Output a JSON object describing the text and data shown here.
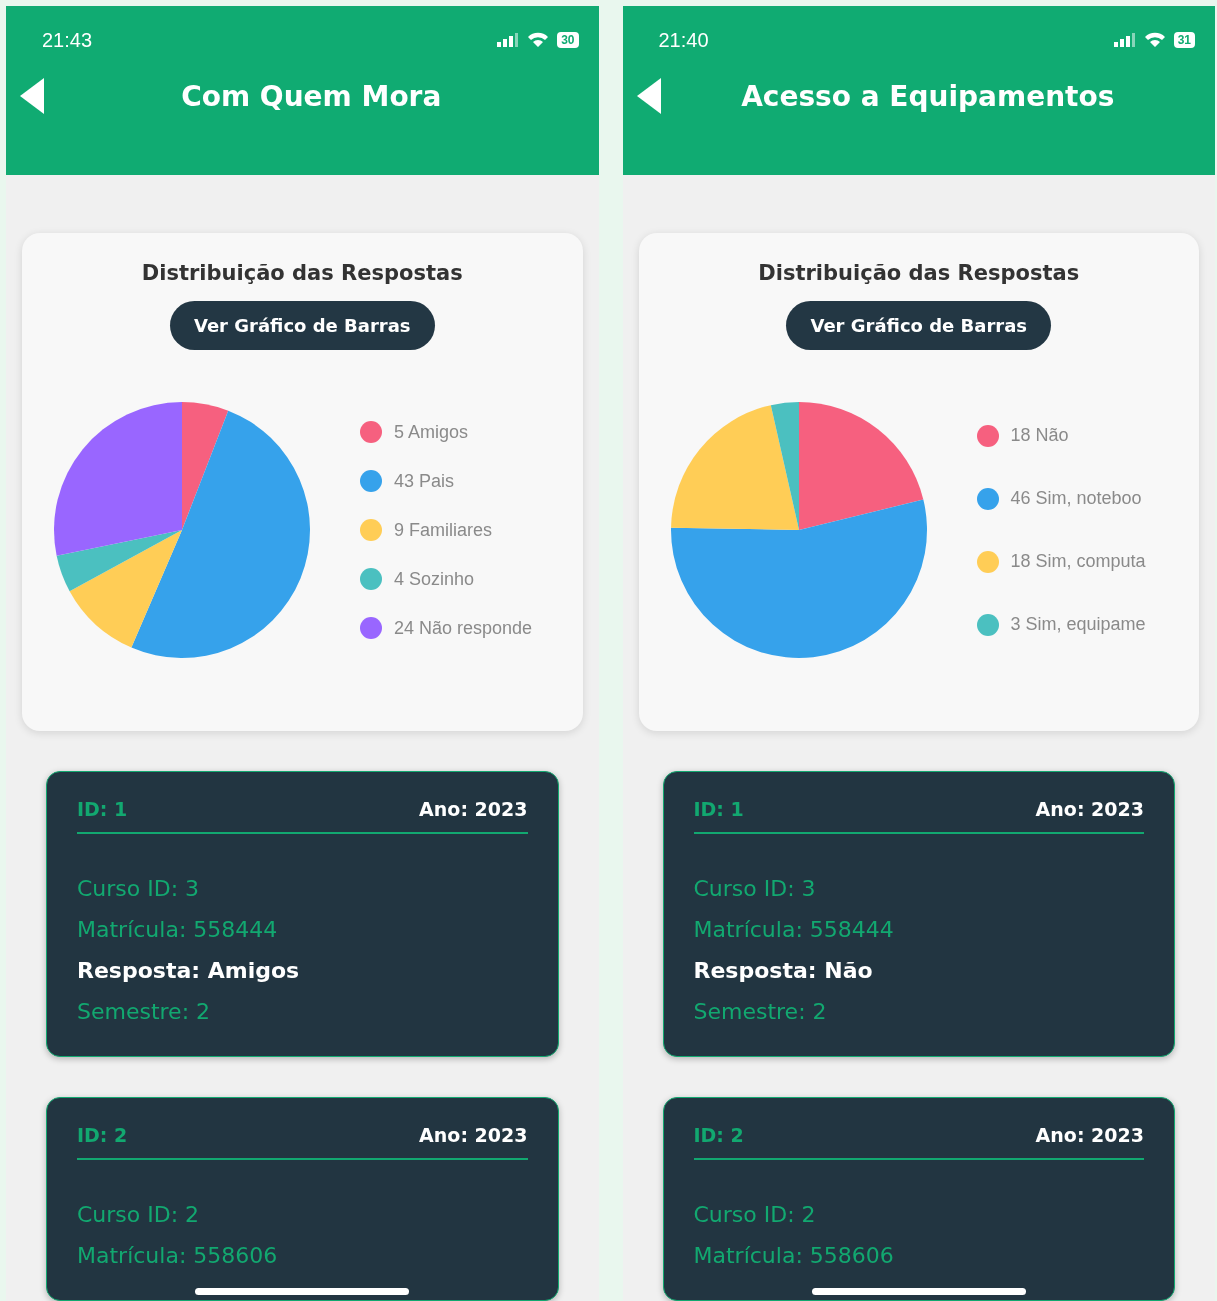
{
  "phones": [
    {
      "status_bar": {
        "time": "21:43",
        "battery": "30"
      },
      "header": {
        "title": "Com Quem Mora"
      },
      "chart_card": {
        "title": "Distribuição das Respostas",
        "button": "Ver Gráfico de Barras",
        "legend": [
          {
            "color": "#f6607f"
          },
          {
            "color": "#36a2eb"
          },
          {
            "color": "#ffcd56"
          },
          {
            "color": "#4bc0c0"
          },
          {
            "color": "#9966ff"
          }
        ],
        "chart_data": {
          "type": "pie",
          "categories": [
            "5 Amigos",
            "43 Pais",
            "9 Familiares",
            "4 Sozinho",
            "24 Não responde"
          ],
          "values": [
            5,
            43,
            9,
            4,
            24
          ]
        }
      },
      "records": [
        {
          "id": "ID: 1",
          "year": "Ano: 2023",
          "fields": [
            {
              "kind": "info",
              "text": "Curso ID: 3"
            },
            {
              "kind": "info",
              "text": "Matrícula: 558444"
            },
            {
              "kind": "answer",
              "text": "Resposta: Amigos"
            },
            {
              "kind": "info",
              "text": "Semestre: 2"
            }
          ]
        },
        {
          "id": "ID: 2",
          "year": "Ano: 2023",
          "fields": [
            {
              "kind": "info",
              "text": "Curso ID: 2"
            },
            {
              "kind": "info",
              "text": "Matrícula: 558606"
            }
          ]
        }
      ]
    },
    {
      "status_bar": {
        "time": "21:40",
        "battery": "31"
      },
      "header": {
        "title": "Acesso a Equipamentos"
      },
      "chart_card": {
        "title": "Distribuição das Respostas",
        "button": "Ver Gráfico de Barras",
        "legend": [
          {
            "color": "#f6607f"
          },
          {
            "color": "#36a2eb"
          },
          {
            "color": "#ffcd56"
          },
          {
            "color": "#4bc0c0"
          }
        ],
        "chart_data": {
          "type": "pie",
          "categories": [
            "18 Não",
            "46 Sim, noteboo",
            "18 Sim, computa",
            "3 Sim, equipame"
          ],
          "values": [
            18,
            46,
            18,
            3
          ]
        }
      },
      "records": [
        {
          "id": "ID: 1",
          "year": "Ano: 2023",
          "fields": [
            {
              "kind": "info",
              "text": "Curso ID: 3"
            },
            {
              "kind": "info",
              "text": "Matrícula: 558444"
            },
            {
              "kind": "answer",
              "text": "Resposta: Não"
            },
            {
              "kind": "info",
              "text": "Semestre: 2"
            }
          ]
        },
        {
          "id": "ID: 2",
          "year": "Ano: 2023",
          "fields": [
            {
              "kind": "info",
              "text": "Curso ID: 2"
            },
            {
              "kind": "info",
              "text": "Matrícula: 558606"
            }
          ]
        }
      ]
    }
  ]
}
